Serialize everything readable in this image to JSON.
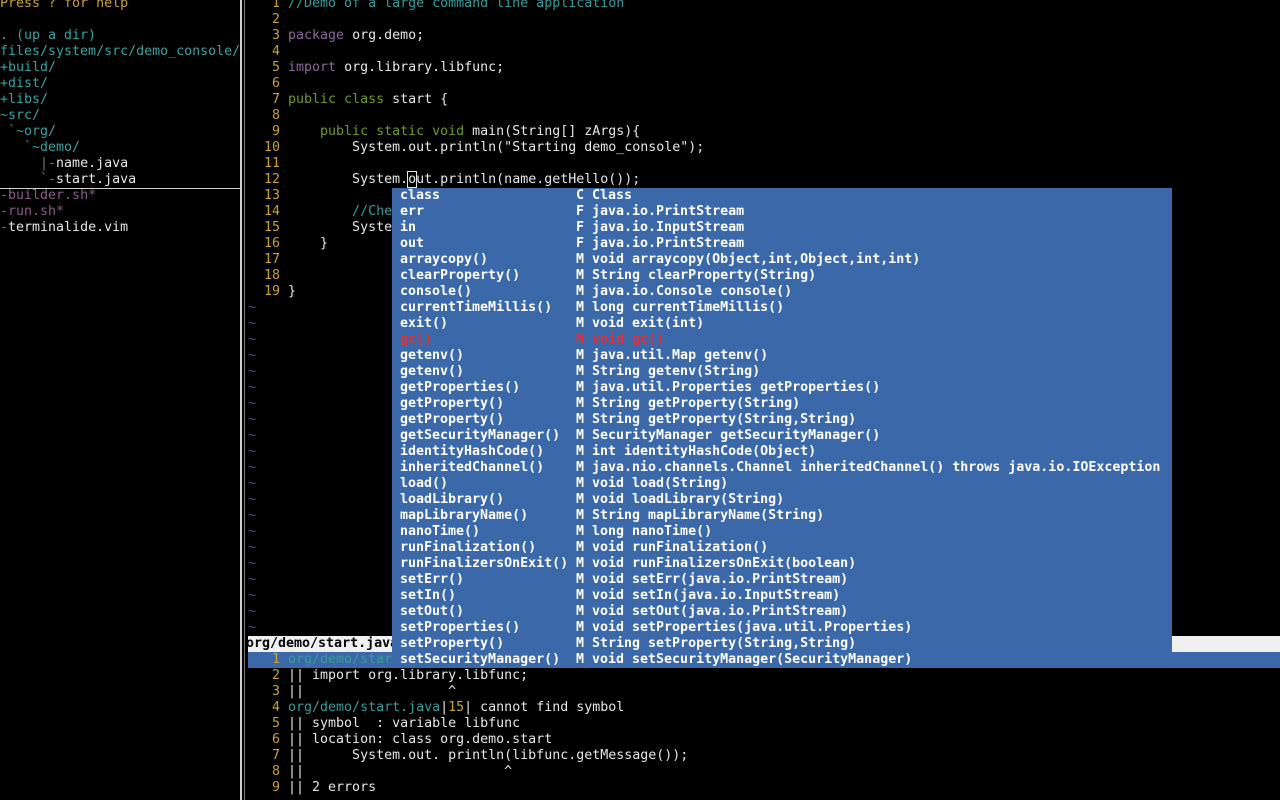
{
  "tree": {
    "help": "Press ? for help",
    "up_dir": ". (up a dir)",
    "root": "files/system/src/demo_console/",
    "entries": [
      {
        "text": "+build/",
        "kind": "dir"
      },
      {
        "text": "+dist/",
        "kind": "dir"
      },
      {
        "text": "+libs/",
        "kind": "dir"
      },
      {
        "text": "~src/",
        "kind": "dir"
      },
      {
        "prefix": " `",
        "text": "~org/",
        "kind": "dir"
      },
      {
        "prefix": "   `",
        "text": "~demo/",
        "kind": "dir"
      },
      {
        "prefix": "     |-",
        "text": "name.java",
        "kind": "file"
      },
      {
        "prefix": "     `-",
        "text": "start.java",
        "kind": "file",
        "cursor": true
      },
      {
        "prefix": "-",
        "text": "builder.sh*",
        "kind": "exe"
      },
      {
        "prefix": "-",
        "text": "run.sh*",
        "kind": "exe"
      },
      {
        "prefix": "-",
        "text": "terminalide.vim",
        "kind": "file"
      }
    ]
  },
  "editor": {
    "lines": [
      [
        [
          "//Demo of a large command line application",
          "comment"
        ]
      ],
      [],
      [
        [
          "package",
          "pkg"
        ],
        [
          " org.demo;",
          "txt"
        ]
      ],
      [],
      [
        [
          "import",
          "pkg"
        ],
        [
          " org.library.libfunc;",
          "txt"
        ]
      ],
      [],
      [
        [
          "public class",
          "kw"
        ],
        [
          " start {",
          "txt"
        ]
      ],
      [],
      [
        [
          "    public static void",
          "kw"
        ],
        [
          " main(String[] zArgs){",
          "txt"
        ]
      ],
      [
        [
          "        System.out.println(\"Starting demo_console\");",
          "txt"
        ]
      ],
      [],
      [
        [
          "        System.",
          "txt"
        ],
        [
          "o",
          "cursor"
        ],
        [
          "ut.println(name.getHello());",
          "txt"
        ]
      ],
      [],
      [
        [
          "        //Chec",
          "comment"
        ]
      ],
      [
        [
          "        System",
          "txt"
        ]
      ],
      [
        [
          "    }",
          "txt"
        ]
      ],
      [],
      [],
      [
        [
          "}",
          "txt"
        ]
      ]
    ],
    "tilde": "~",
    "status": "org/demo/start.java"
  },
  "completion": {
    "selected_index": 9,
    "items": [
      {
        "name": "class",
        "kind": "C",
        "sig": "Class"
      },
      {
        "name": "err",
        "kind": "F",
        "sig": "java.io.PrintStream"
      },
      {
        "name": "in",
        "kind": "F",
        "sig": "java.io.InputStream"
      },
      {
        "name": "out",
        "kind": "F",
        "sig": "java.io.PrintStream"
      },
      {
        "name": "arraycopy()",
        "kind": "M",
        "sig": "void arraycopy(Object,int,Object,int,int)"
      },
      {
        "name": "clearProperty()",
        "kind": "M",
        "sig": "String clearProperty(String)"
      },
      {
        "name": "console()",
        "kind": "M",
        "sig": "java.io.Console console()"
      },
      {
        "name": "currentTimeMillis()",
        "kind": "M",
        "sig": "long currentTimeMillis()"
      },
      {
        "name": "exit()",
        "kind": "M",
        "sig": "void exit(int)"
      },
      {
        "name": "gc()",
        "kind": "M",
        "sig": "void gc()"
      },
      {
        "name": "getenv()",
        "kind": "M",
        "sig": "java.util.Map getenv()"
      },
      {
        "name": "getenv()",
        "kind": "M",
        "sig": "String getenv(String)"
      },
      {
        "name": "getProperties()",
        "kind": "M",
        "sig": "java.util.Properties getProperties()"
      },
      {
        "name": "getProperty()",
        "kind": "M",
        "sig": "String getProperty(String)"
      },
      {
        "name": "getProperty()",
        "kind": "M",
        "sig": "String getProperty(String,String)"
      },
      {
        "name": "getSecurityManager()",
        "kind": "M",
        "sig": "SecurityManager getSecurityManager()"
      },
      {
        "name": "identityHashCode()",
        "kind": "M",
        "sig": "int identityHashCode(Object)"
      },
      {
        "name": "inheritedChannel()",
        "kind": "M",
        "sig": "java.nio.channels.Channel inheritedChannel() throws java.io.IOException"
      },
      {
        "name": "load()",
        "kind": "M",
        "sig": "void load(String)"
      },
      {
        "name": "loadLibrary()",
        "kind": "M",
        "sig": "void loadLibrary(String)"
      },
      {
        "name": "mapLibraryName()",
        "kind": "M",
        "sig": "String mapLibraryName(String)"
      },
      {
        "name": "nanoTime()",
        "kind": "M",
        "sig": "long nanoTime()"
      },
      {
        "name": "runFinalization()",
        "kind": "M",
        "sig": "void runFinalization()"
      },
      {
        "name": "runFinalizersOnExit()",
        "kind": "M",
        "sig": "void runFinalizersOnExit(boolean)"
      },
      {
        "name": "setErr()",
        "kind": "M",
        "sig": "void setErr(java.io.PrintStream)"
      },
      {
        "name": "setIn()",
        "kind": "M",
        "sig": "void setIn(java.io.InputStream)"
      },
      {
        "name": "setOut()",
        "kind": "M",
        "sig": "void setOut(java.io.PrintStream)"
      },
      {
        "name": "setProperties()",
        "kind": "M",
        "sig": "void setProperties(java.util.Properties)"
      },
      {
        "name": "setProperty()",
        "kind": "M",
        "sig": "String setProperty(String,String)"
      },
      {
        "name": "setSecurityManager()",
        "kind": "M",
        "sig": "void setSecurityManager(SecurityManager)"
      }
    ]
  },
  "quickfix": {
    "lines": [
      [
        [
          "org/demo/start",
          "comment"
        ]
      ],
      [
        [
          "|| import org.library.libfunc;",
          "txt"
        ]
      ],
      [
        [
          "||                  ^",
          "txt"
        ]
      ],
      [
        [
          "org/demo/start.java",
          "comment"
        ],
        [
          "|",
          "txt"
        ],
        [
          "15",
          "num"
        ],
        [
          "| cannot find symbol",
          "txt"
        ]
      ],
      [
        [
          "|| symbol  : variable libfunc",
          "txt"
        ]
      ],
      [
        [
          "|| location: class org.demo.start",
          "txt"
        ]
      ],
      [
        [
          "||      System.out. println(libfunc.getMessage());",
          "txt"
        ]
      ],
      [
        [
          "||                         ^",
          "txt"
        ]
      ],
      [
        [
          "|| 2 errors",
          "txt"
        ]
      ]
    ]
  },
  "colors": {
    "popup_bg": "#3a68a8",
    "selected": "#e0303a",
    "line_number": "#c9a23c"
  }
}
